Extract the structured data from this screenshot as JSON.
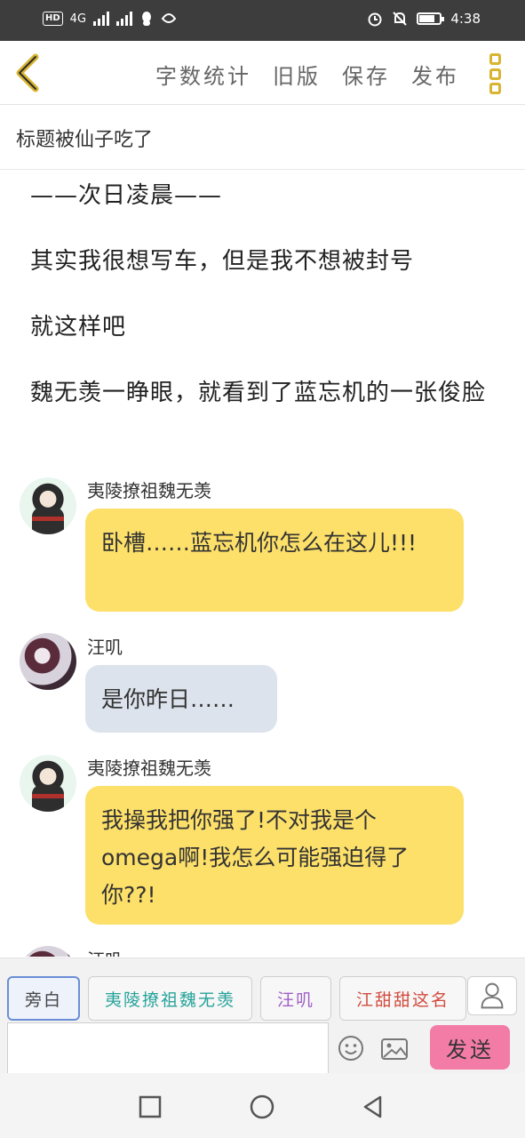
{
  "status_bar": {
    "left_text": "HD",
    "network": "4G",
    "time": "4:38"
  },
  "toolbar": {
    "word_count": "字数统计",
    "old_version": "旧版",
    "save": "保存",
    "publish": "发布"
  },
  "title_text": "标题被仙子吃了",
  "paragraphs": [
    "——次日凌晨——",
    "其实我很想写车，但是我不想被封号",
    "就这样吧",
    "魏无羡一睁眼，就看到了蓝忘机的一张俊脸"
  ],
  "messages": [
    {
      "name": "夷陵撩祖魏无羡",
      "text": "卧槽……蓝忘机你怎么在这儿!!!"
    },
    {
      "name": "汪叽",
      "text": "是你昨日……"
    },
    {
      "name": "夷陵撩祖魏无羡",
      "text": "我操我把你强了!不对我是个omega啊!我怎么可能强迫得了你??!"
    },
    {
      "name": "汪叽"
    }
  ],
  "role_chips": [
    "旁白",
    "夷陵撩祖魏无羡",
    "汪叽",
    "江甜甜这名"
  ],
  "send_label": "发送",
  "input_value": "",
  "colors": {
    "accent_yellow": "#fde06a",
    "send_pink": "#f37ca6",
    "kebab": "#d8b430",
    "back": "#d8b430"
  }
}
